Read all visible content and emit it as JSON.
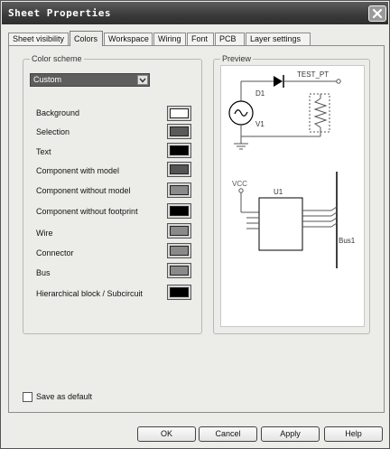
{
  "window": {
    "title": "Sheet Properties"
  },
  "tabs": [
    {
      "label": "Sheet visibility",
      "active": false
    },
    {
      "label": "Colors",
      "active": true
    },
    {
      "label": "Workspace",
      "active": false
    },
    {
      "label": "Wiring",
      "active": false
    },
    {
      "label": "Font",
      "active": false
    },
    {
      "label": "PCB",
      "active": false
    },
    {
      "label": "Layer settings",
      "active": false
    }
  ],
  "color_scheme": {
    "legend": "Color scheme",
    "selected": "Custom",
    "items": [
      {
        "label": "Background",
        "color": "#ffffff"
      },
      {
        "label": "Selection",
        "color": "#5a5a5a"
      },
      {
        "label": "Text",
        "color": "#000000"
      },
      {
        "label": "Component with model",
        "color": "#555555"
      },
      {
        "label": "Component without model",
        "color": "#8a8a8a"
      },
      {
        "label": "Component without footprint",
        "color": "#000000"
      },
      {
        "label": "Wire",
        "color": "#8a8a8a"
      },
      {
        "label": "Connector",
        "color": "#8a8a8a"
      },
      {
        "label": "Bus",
        "color": "#8a8a8a"
      },
      {
        "label": "Hierarchical block / Subcircuit",
        "color": "#000000"
      }
    ]
  },
  "preview": {
    "legend": "Preview",
    "labels": {
      "d1": "D1",
      "test_pt": "TEST_PT",
      "v1": "V1",
      "vcc": "VCC",
      "u1": "U1",
      "bus1": "Bus1"
    }
  },
  "save_as_default": {
    "label": "Save as default",
    "checked": false
  },
  "buttons": {
    "ok": "OK",
    "cancel": "Cancel",
    "apply": "Apply",
    "help": "Help"
  }
}
